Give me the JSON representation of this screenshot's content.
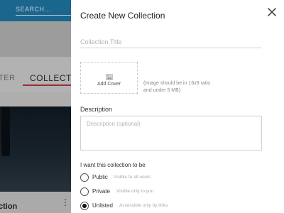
{
  "background": {
    "search_placeholder": "SEARCH...",
    "tab_filter": "TER",
    "tab_collections": "COLLECTION",
    "card_title": "ction",
    "card_menu": "⋮"
  },
  "modal": {
    "title": "Create New Collection",
    "close_icon": "close-icon",
    "title_placeholder": "Collection Title",
    "cover_label": "Add Cover",
    "cover_icon": "image-icon",
    "cover_hint": "(Image should be in 16x9 ratio and under 5 MB)",
    "description_label": "Description",
    "description_placeholder": "Description (optional)",
    "visibility_label": "I want this collection to be",
    "visibility_options": [
      {
        "label": "Public",
        "hint": "Visible to all users",
        "selected": false
      },
      {
        "label": "Private",
        "hint": "Visible only to you",
        "selected": false
      },
      {
        "label": "Unlisted",
        "hint": "Accessible only by links",
        "selected": true
      }
    ]
  },
  "colors": {
    "header": "#1e6f9a",
    "tab_underline": "#a7333c"
  }
}
